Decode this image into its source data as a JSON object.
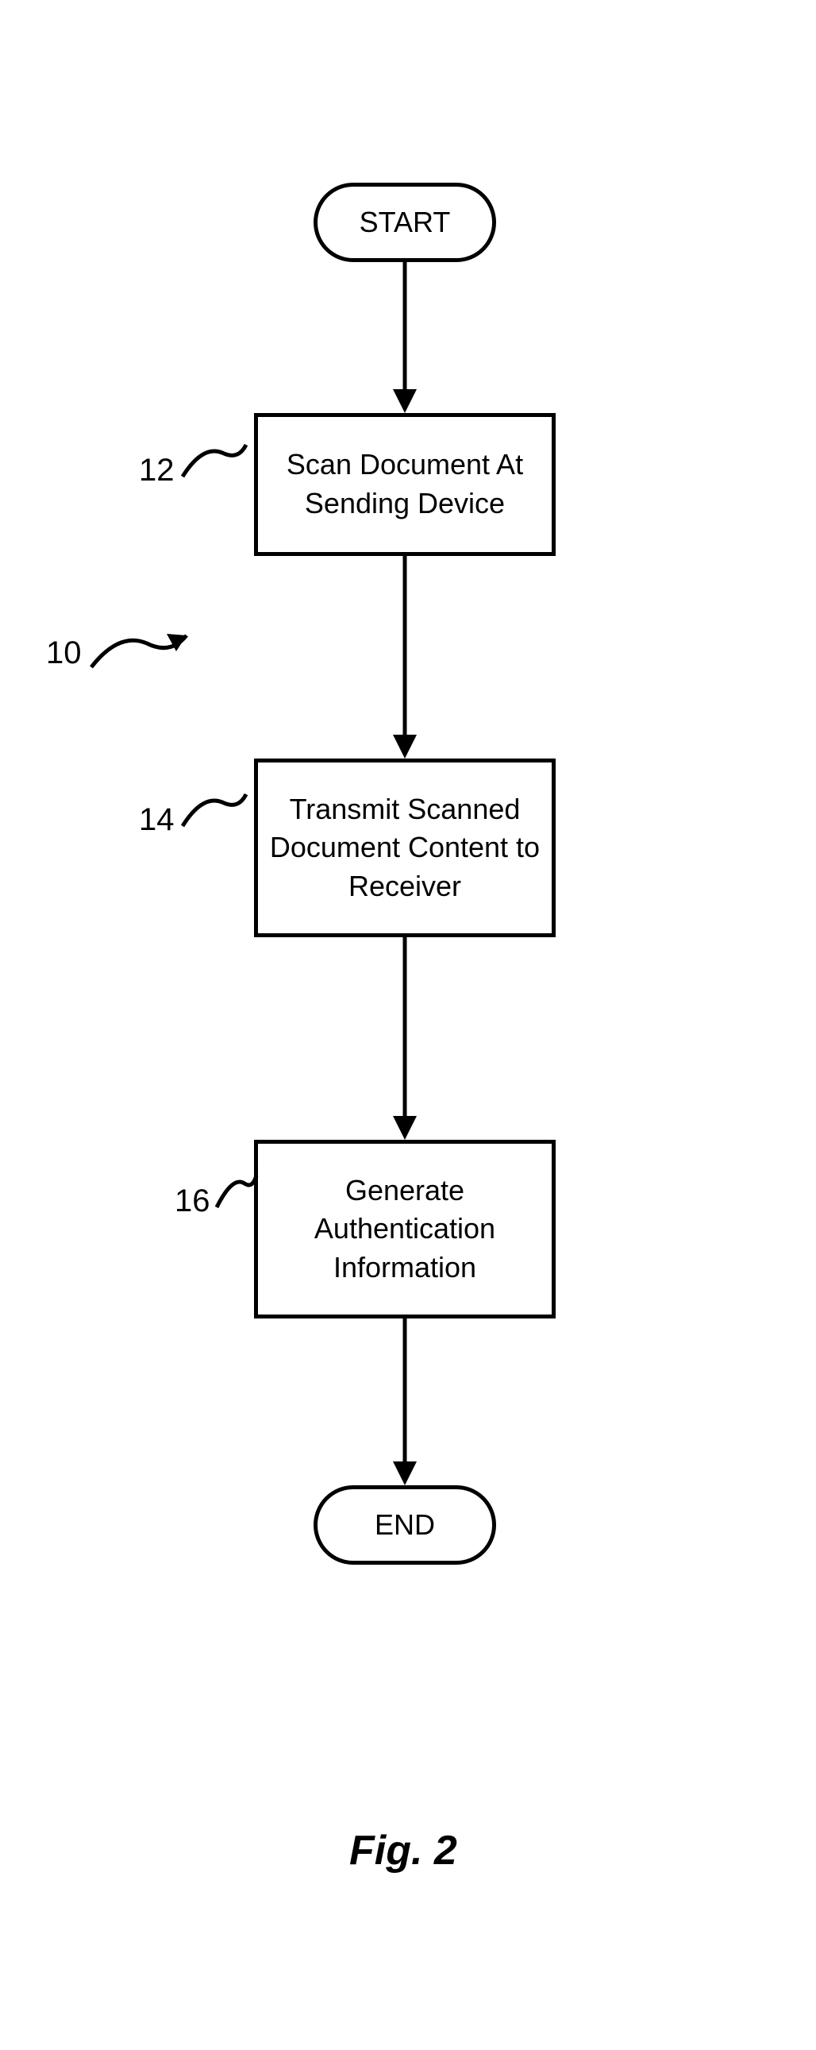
{
  "flowchart": {
    "start": "START",
    "step1": "Scan Document At Sending Device",
    "step2": "Transmit Scanned Document Content to Receiver",
    "step3": "Generate Authentication Information",
    "end": "END"
  },
  "refs": {
    "r10": "10",
    "r12": "12",
    "r14": "14",
    "r16": "16"
  },
  "figure": "Fig. 2"
}
